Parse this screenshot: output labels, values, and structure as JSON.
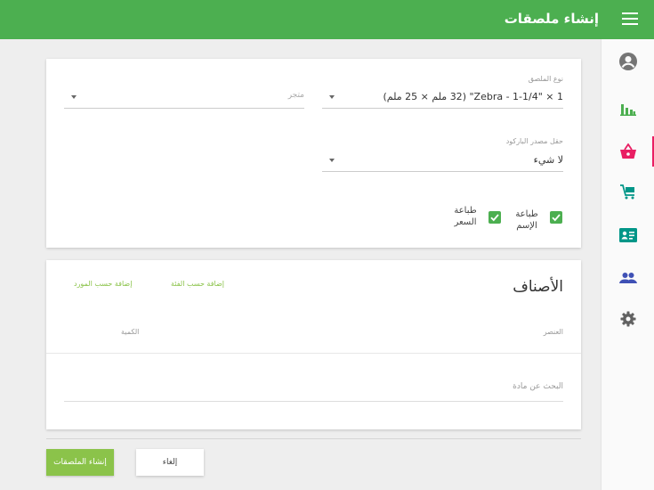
{
  "header": {
    "title": "إنشاء ملصقات",
    "menu_icon": "hamburger-menu-icon"
  },
  "nav": {
    "items": [
      {
        "name": "account-icon",
        "color": "#757575"
      },
      {
        "name": "bar-chart-icon",
        "color": "#4caf50"
      },
      {
        "name": "shopping-basket-icon",
        "color": "#e91e63",
        "active": true
      },
      {
        "name": "cart-icon",
        "color": "#009688"
      },
      {
        "name": "contact-card-icon",
        "color": "#009688"
      },
      {
        "name": "people-icon",
        "color": "#3f51b5"
      },
      {
        "name": "settings-gear-icon",
        "color": "#616161"
      }
    ]
  },
  "form": {
    "label_type": {
      "label": "نوع الملصق",
      "value": "Zebra - 1-1/4\" × 1\" (32 ملم × 25 ملم)"
    },
    "store": {
      "placeholder": "متجر"
    },
    "barcode_source": {
      "label": "حقل مصدر الباركود",
      "value": "لا شيء"
    },
    "print_name": {
      "label_line1": "طباعة",
      "label_line2": "الإسم",
      "checked": true
    },
    "print_price": {
      "label_line1": "طباعة",
      "label_line2": "السعر",
      "checked": true
    }
  },
  "items_section": {
    "title": "الأصناف",
    "add_by_category": "إضافة حسب الفئة",
    "add_by_supplier": "إضافة حسب المورد",
    "col_item": "العنصر",
    "col_quantity": "الكمية",
    "search_placeholder": "البحث عن مادة"
  },
  "actions": {
    "create_label": "إنشاء الملصقات",
    "cancel_label": "إلغاء"
  },
  "colors": {
    "primary": "#4caf50",
    "accent": "#8bc34a",
    "active_nav": "#e91e63"
  }
}
